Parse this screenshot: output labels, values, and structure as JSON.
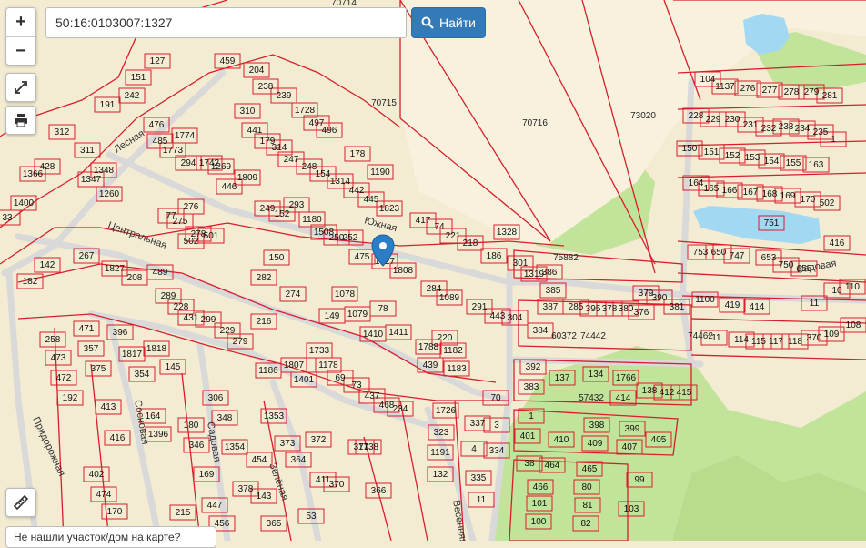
{
  "search": {
    "value": "50:16:0103007:1327",
    "button_label": "Найти"
  },
  "controls": {
    "zoom_in": "+",
    "zoom_out": "−"
  },
  "streets": [
    "Лесная",
    "Центральная",
    "Южная",
    "Садовая",
    "Сосновая",
    "Придорожная",
    "Весенняя",
    "Зелёная",
    "Садовая"
  ],
  "blocks": [
    "70714",
    "70715",
    "70716",
    "73020",
    "75882",
    "60372",
    "57432",
    "74462",
    "74442"
  ],
  "parcels": [
    "151",
    "127",
    "191",
    "242",
    "459",
    "204",
    "238",
    "239",
    "310",
    "441",
    "179",
    "314",
    "247",
    "248",
    "154",
    "1314",
    "442",
    "445",
    "1190",
    "1728",
    "497",
    "496",
    "178",
    "1823",
    "476",
    "485",
    "1773",
    "1774",
    "294",
    "1742",
    "1269",
    "446",
    "1809",
    "312",
    "311",
    "428",
    "1366",
    "1347",
    "1348",
    "1260",
    "1400",
    "33",
    "77",
    "275",
    "276",
    "502",
    "278",
    "501",
    "249",
    "152",
    "293",
    "1180",
    "1508",
    "250",
    "252",
    "475",
    "1327",
    "1808",
    "417",
    "74",
    "221",
    "218",
    "186",
    "1328",
    "301",
    "1319",
    "386",
    "385",
    "387",
    "384",
    "267",
    "142",
    "182",
    "1827",
    "208",
    "489",
    "289",
    "228",
    "431",
    "299",
    "229",
    "279",
    "216",
    "274",
    "282",
    "150",
    "149",
    "1078",
    "1079",
    "78",
    "1410",
    "1411",
    "284",
    "1089",
    "291",
    "443",
    "304",
    "258",
    "471",
    "473",
    "357",
    "472",
    "375",
    "192",
    "396",
    "1817",
    "1818",
    "354",
    "145",
    "1186",
    "1807",
    "1401",
    "1733",
    "1178",
    "69",
    "73",
    "437",
    "468",
    "234",
    "1788",
    "220",
    "1182",
    "439",
    "1183",
    "285",
    "395",
    "378",
    "380",
    "376",
    "379",
    "390",
    "381",
    "392",
    "383",
    "137",
    "134",
    "1766",
    "138",
    "412",
    "415",
    "414",
    "413",
    "416",
    "164",
    "1396",
    "180",
    "346",
    "306",
    "348",
    "1354",
    "1353",
    "454",
    "373",
    "364",
    "372",
    "371",
    "1738",
    "1726",
    "323",
    "1191",
    "132",
    "337",
    "3",
    "4",
    "334",
    "335",
    "11",
    "70",
    "1",
    "398",
    "399",
    "401",
    "410",
    "409",
    "407",
    "405",
    "402",
    "474",
    "170",
    "169",
    "447",
    "215",
    "456",
    "411",
    "370",
    "378",
    "143",
    "365",
    "366",
    "53",
    "38",
    "464",
    "465",
    "466",
    "80",
    "101",
    "81",
    "100",
    "82",
    "99",
    "103",
    "104",
    "1137",
    "276",
    "277",
    "278",
    "279",
    "281",
    "228",
    "229",
    "230",
    "231",
    "232",
    "233",
    "234",
    "235",
    "150",
    "151",
    "152",
    "153",
    "154",
    "155",
    "163",
    "164",
    "165",
    "166",
    "167",
    "168",
    "169",
    "170",
    "502",
    "751",
    "753",
    "650",
    "747",
    "653",
    "750",
    "655",
    "416",
    "1100",
    "419",
    "414",
    "11",
    "10",
    "110",
    "111",
    "114",
    "115",
    "117",
    "118",
    "370",
    "109",
    "108",
    "1"
  ],
  "marker": {
    "selected_parcel": "50:16:0103007:1327"
  },
  "bottom_text": "Не нашли участок/дом на карте?",
  "colors": {
    "boundary": "#d81e2c",
    "land": "#f3ecd2",
    "forest": "#c2e39a",
    "water": "#a3d8f2",
    "marker": "#2b7dc5",
    "button": "#337ab7"
  },
  "icons": [
    "fullscreen-icon",
    "print-icon",
    "search-icon",
    "ruler-icon",
    "map-marker-icon"
  ]
}
